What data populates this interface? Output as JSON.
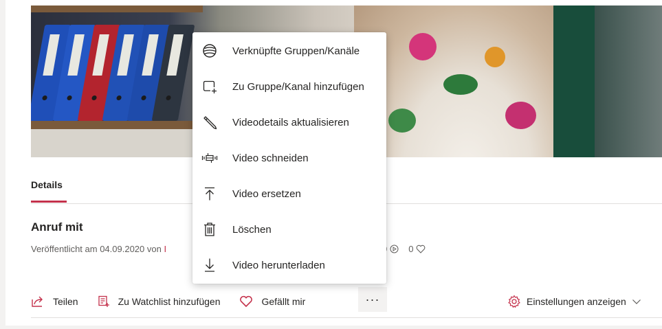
{
  "tabs": {
    "details": "Details"
  },
  "video": {
    "title": "Anruf mit",
    "published_prefix": "Veröffentlicht am 04.09.2020 von",
    "author_visible": "I",
    "views": "0",
    "likes": "0"
  },
  "actions": {
    "share": "Teilen",
    "watchlist": "Zu Watchlist hinzufügen",
    "like": "Gefällt mir",
    "more": "···",
    "settings": "Einstellungen anzeigen"
  },
  "menu": {
    "items": [
      {
        "label": "Verknüpfte Gruppen/Kanäle",
        "icon": "linked-groups-icon"
      },
      {
        "label": "Zu Gruppe/Kanal hinzufügen",
        "icon": "add-to-group-icon"
      },
      {
        "label": "Videodetails aktualisieren",
        "icon": "pencil-icon"
      },
      {
        "label": "Video schneiden",
        "icon": "trim-icon"
      },
      {
        "label": "Video ersetzen",
        "icon": "upload-replace-icon"
      },
      {
        "label": "Löschen",
        "icon": "trash-icon"
      },
      {
        "label": "Video herunterladen",
        "icon": "download-icon"
      }
    ]
  },
  "colors": {
    "accent": "#c4314b",
    "text": "#252423",
    "muted": "#605e5c"
  }
}
